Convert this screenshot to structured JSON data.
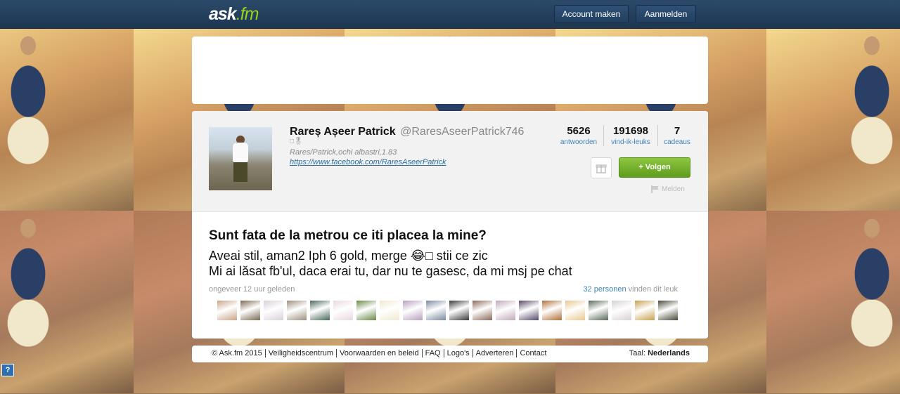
{
  "topbar": {
    "logo_main": "ask",
    "logo_suffix": ".fm",
    "register_label": "Account maken",
    "login_label": "Aanmelden"
  },
  "profile": {
    "name": "Rareș Așeer Patrick",
    "handle": "@RaresAseerPatrick746",
    "emoji_line": "□🎖",
    "bio": "Rares/Patrick,ochi albastri,1.83",
    "link": "https://www.facebook.com/RaresAseerPatrick",
    "stats": [
      {
        "value": "5626",
        "label": "antwoorden"
      },
      {
        "value": "191698",
        "label": "vind-ik-leuks"
      },
      {
        "value": "7",
        "label": "cadeaus"
      }
    ],
    "follow_label": "+ Volgen",
    "report_label": "Melden"
  },
  "post": {
    "question": "Sunt fata de la metrou ce iti placea la mine?",
    "answer_line1": "Aveai stil, aman2 Iph 6 gold, merge 😂□ stii ce zic",
    "answer_line2": "Mi ai lăsat fb'ul, daca erai tu, dar nu te gasesc, da mi msj pe chat",
    "time": "ongeveer 12 uur geleden",
    "likes_count": "32 personen",
    "likes_suffix": " vinden dit leuk",
    "liker_colors": [
      "#c9a58a",
      "#7b6a55",
      "#d8d0d8",
      "#9c9080",
      "#4a6a5a",
      "#e8d8e0",
      "#6a8a4a",
      "#f0e8d0",
      "#b8a0c0",
      "#7a8aa0",
      "#3a3a3a",
      "#8a6a5a",
      "#c0a8b8",
      "#5a4a6a",
      "#b0703a",
      "#e8c890",
      "#5a6a5a",
      "#d8d0d0",
      "#c8a050",
      "#4a4a3a"
    ]
  },
  "footer": {
    "links": [
      "© Ask.fm 2015",
      "Veiligheidscentrum",
      "Voorwaarden en beleid",
      "FAQ",
      "Logo's",
      "Adverteren",
      "Contact"
    ],
    "lang_prefix": "Taal: ",
    "lang": "Nederlands"
  },
  "help_label": "?"
}
